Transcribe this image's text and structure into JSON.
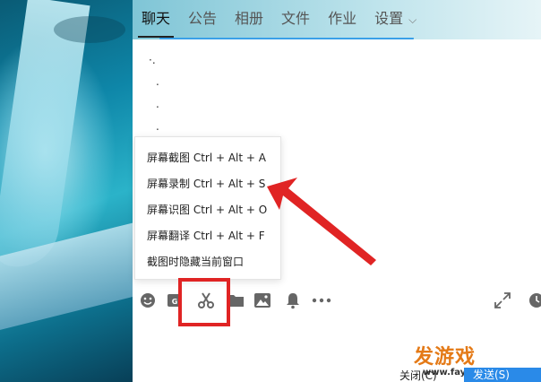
{
  "tabs": [
    {
      "label": "聊天",
      "active": true
    },
    {
      "label": "公告"
    },
    {
      "label": "相册"
    },
    {
      "label": "文件"
    },
    {
      "label": "作业"
    },
    {
      "label": "设置"
    }
  ],
  "chat_dots": [
    "·.",
    ".",
    ".",
    "."
  ],
  "screenshot_menu": {
    "items": [
      "屏幕截图 Ctrl + Alt + A",
      "屏幕录制 Ctrl + Alt + S",
      "屏幕识图 Ctrl + Alt + O",
      "屏幕翻译 Ctrl + Alt + F",
      "截图时隐藏当前窗口"
    ]
  },
  "toolbar_icons": [
    "emoji-icon",
    "gif-icon",
    "scissors-icon",
    "folder-icon",
    "image-icon",
    "bell-icon",
    "more-icon",
    "expand-icon",
    "clock-icon"
  ],
  "bottom": {
    "close_label": "关闭(C)",
    "send_label": "发送(S)"
  },
  "watermark": {
    "brand": "发游戏",
    "url": "www.fayouxi.com"
  },
  "colors": {
    "accent_blue": "#2a8ae8",
    "highlight_red": "#e02424",
    "watermark_orange": "#e47a17"
  }
}
